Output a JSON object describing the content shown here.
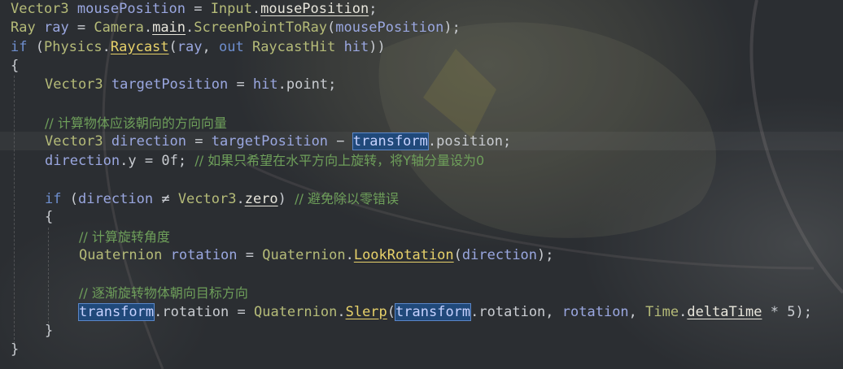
{
  "lines": [
    {
      "indent": 0,
      "tokens": [
        [
          "type",
          "Vector3"
        ],
        [
          "p",
          " "
        ],
        [
          "var",
          "mousePosition"
        ],
        [
          "p",
          " = "
        ],
        [
          "type",
          "Input"
        ],
        [
          "p",
          "."
        ],
        [
          "mp",
          "mousePosition"
        ],
        [
          "p",
          ";"
        ]
      ]
    },
    {
      "indent": 0,
      "tokens": [
        [
          "type",
          "Ray"
        ],
        [
          "p",
          " "
        ],
        [
          "var",
          "ray"
        ],
        [
          "p",
          " = "
        ],
        [
          "type",
          "Camera"
        ],
        [
          "p",
          "."
        ],
        [
          "mp",
          "main"
        ],
        [
          "p",
          "."
        ],
        [
          "type",
          "ScreenPointToRay"
        ],
        [
          "p",
          "("
        ],
        [
          "var",
          "mousePosition"
        ],
        [
          "p",
          ");"
        ]
      ]
    },
    {
      "indent": 0,
      "tokens": [
        [
          "kw",
          "if"
        ],
        [
          "p",
          " ("
        ],
        [
          "type",
          "Physics"
        ],
        [
          "p",
          "."
        ],
        [
          "m",
          "Raycast"
        ],
        [
          "p",
          "("
        ],
        [
          "var",
          "ray"
        ],
        [
          "p",
          ", "
        ],
        [
          "kw",
          "out"
        ],
        [
          "p",
          " "
        ],
        [
          "type",
          "RaycastHit"
        ],
        [
          "p",
          " "
        ],
        [
          "var",
          "hit"
        ],
        [
          "p",
          "))"
        ]
      ]
    },
    {
      "indent": 0,
      "tokens": [
        [
          "p",
          "{"
        ]
      ]
    },
    {
      "indent": 1,
      "tokens": [
        [
          "type",
          "Vector3"
        ],
        [
          "p",
          " "
        ],
        [
          "var",
          "targetPosition"
        ],
        [
          "p",
          " = "
        ],
        [
          "var",
          "hit"
        ],
        [
          "p",
          "."
        ],
        [
          "prop",
          "point"
        ],
        [
          "p",
          ";"
        ]
      ]
    },
    {
      "indent": 0,
      "tokens": []
    },
    {
      "indent": 1,
      "tokens": [
        [
          "cm",
          "// 计算物体应该朝向的方向向量"
        ]
      ]
    },
    {
      "indent": 1,
      "tokens": [
        [
          "type",
          "Vector3"
        ],
        [
          "p",
          " "
        ],
        [
          "var",
          "direction"
        ],
        [
          "p",
          " = "
        ],
        [
          "var",
          "targetPosition"
        ],
        [
          "p",
          " − "
        ],
        [
          "hl",
          "transform"
        ],
        [
          "p",
          "."
        ],
        [
          "prop",
          "position"
        ],
        [
          "p",
          ";"
        ]
      ]
    },
    {
      "indent": 1,
      "tokens": [
        [
          "var",
          "direction"
        ],
        [
          "p",
          "."
        ],
        [
          "prop",
          "y"
        ],
        [
          "p",
          " = "
        ],
        [
          "num",
          "0f"
        ],
        [
          "p",
          "; "
        ],
        [
          "cm",
          "// 如果只希望在水平方向上旋转，将Y轴分量设为0"
        ]
      ]
    },
    {
      "indent": 0,
      "tokens": []
    },
    {
      "indent": 1,
      "tokens": [
        [
          "kw",
          "if"
        ],
        [
          "p",
          " ("
        ],
        [
          "var",
          "direction"
        ],
        [
          "p",
          " ≠ "
        ],
        [
          "type",
          "Vector3"
        ],
        [
          "p",
          "."
        ],
        [
          "mp",
          "zero"
        ],
        [
          "p",
          ") "
        ],
        [
          "cm",
          "// 避免除以零错误"
        ]
      ]
    },
    {
      "indent": 1,
      "tokens": [
        [
          "p",
          "{"
        ]
      ]
    },
    {
      "indent": 2,
      "tokens": [
        [
          "cm",
          "// 计算旋转角度"
        ]
      ]
    },
    {
      "indent": 2,
      "tokens": [
        [
          "type",
          "Quaternion"
        ],
        [
          "p",
          " "
        ],
        [
          "var",
          "rotation"
        ],
        [
          "p",
          " = "
        ],
        [
          "type",
          "Quaternion"
        ],
        [
          "p",
          "."
        ],
        [
          "m",
          "LookRotation"
        ],
        [
          "p",
          "("
        ],
        [
          "var",
          "direction"
        ],
        [
          "p",
          ");"
        ]
      ]
    },
    {
      "indent": 0,
      "tokens": []
    },
    {
      "indent": 2,
      "tokens": [
        [
          "cm",
          "// 逐渐旋转物体朝向目标方向"
        ]
      ]
    },
    {
      "indent": 2,
      "tokens": [
        [
          "hl",
          "transform"
        ],
        [
          "p",
          "."
        ],
        [
          "prop",
          "rotation"
        ],
        [
          "p",
          " = "
        ],
        [
          "type",
          "Quaternion"
        ],
        [
          "p",
          "."
        ],
        [
          "m",
          "Slerp"
        ],
        [
          "p",
          "("
        ],
        [
          "hl",
          "transform"
        ],
        [
          "p",
          "."
        ],
        [
          "prop",
          "rotation"
        ],
        [
          "p",
          ", "
        ],
        [
          "var",
          "rotation"
        ],
        [
          "p",
          ", "
        ],
        [
          "type",
          "Time"
        ],
        [
          "p",
          "."
        ],
        [
          "mp",
          "deltaTime"
        ],
        [
          "p",
          " * "
        ],
        [
          "num",
          "5"
        ],
        [
          "p",
          ");"
        ]
      ]
    },
    {
      "indent": 1,
      "tokens": [
        [
          "p",
          "}"
        ]
      ]
    },
    {
      "indent": 0,
      "tokens": [
        [
          "p",
          "}"
        ]
      ]
    }
  ]
}
